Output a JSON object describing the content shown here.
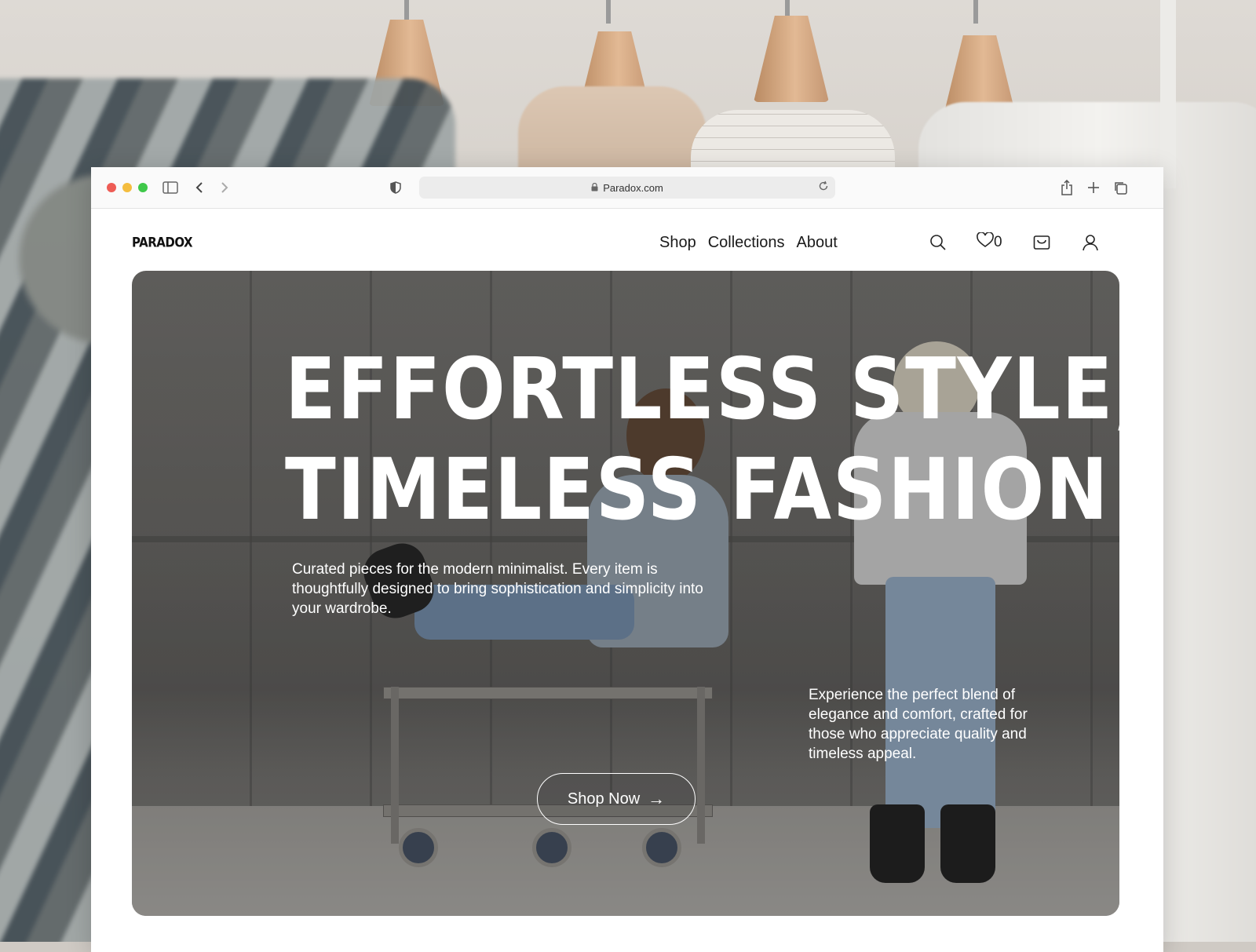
{
  "browser": {
    "url": "Paradox.com",
    "traffic_lights": {
      "close": "#ee5c55",
      "minimize": "#f4bd3f",
      "zoom": "#3fc84a"
    }
  },
  "site": {
    "logo": "PARADOX",
    "nav": [
      "Shop",
      "Collections",
      "About"
    ],
    "wishlist_count": "0",
    "icons": [
      "search-icon",
      "heart-icon",
      "bag-icon",
      "user-icon"
    ]
  },
  "hero": {
    "headline_line1": "EFFORTLESS STYLE,",
    "headline_line2": "TIMELESS FASHION",
    "lead": "Curated pieces for the modern minimalist. Every item is thoughtfully designed to bring sophistication and simplicity into your wardrobe.",
    "side_text": "Experience the perfect blend of elegance and comfort, crafted for those who appreciate quality and timeless appeal.",
    "cta_label": "Shop Now"
  }
}
